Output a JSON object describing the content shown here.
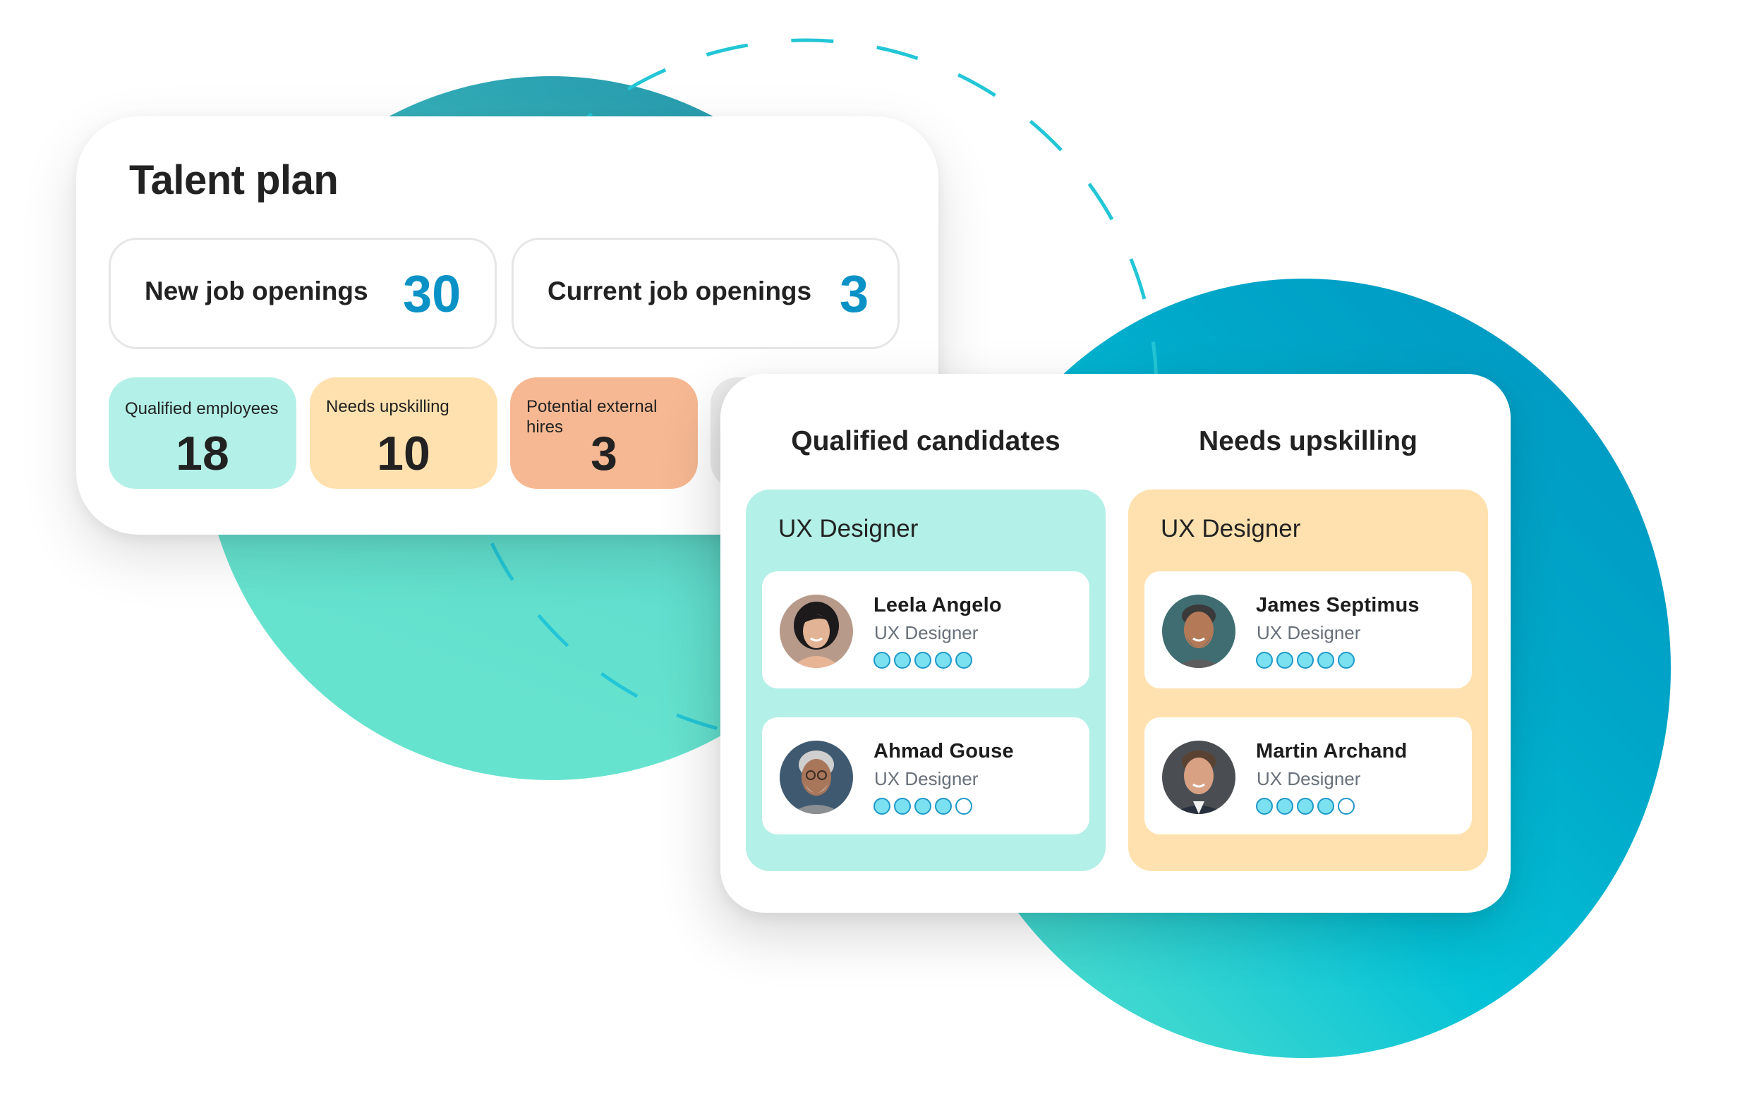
{
  "talent_plan": {
    "title": "Talent plan",
    "stats": [
      {
        "label": "New job openings",
        "value": "30"
      },
      {
        "label": "Current job openings",
        "value": "3"
      }
    ],
    "tiles": [
      {
        "label": "Qualified employees",
        "value": "18",
        "color": "#b3f0e7"
      },
      {
        "label": "Needs upskilling",
        "value": "10",
        "color": "#fee1ae"
      },
      {
        "label": "Potential external hires",
        "value": "3",
        "color": "#f6b892"
      }
    ]
  },
  "candidates": {
    "columns": [
      {
        "heading": "Qualified candidates",
        "group_title": "UX Designer",
        "color": "#b3f0e7",
        "people": [
          {
            "name": "Leela Angelo",
            "role": "UX Designer",
            "rating": 5,
            "rating_max": 5
          },
          {
            "name": "Ahmad Gouse",
            "role": "UX Designer",
            "rating": 4,
            "rating_max": 5
          }
        ]
      },
      {
        "heading": "Needs upskilling",
        "group_title": "UX Designer",
        "color": "#fee1ae",
        "people": [
          {
            "name": "James Septimus",
            "role": "UX Designer",
            "rating": 5,
            "rating_max": 5
          },
          {
            "name": "Martin Archand",
            "role": "UX Designer",
            "rating": 4,
            "rating_max": 5
          }
        ]
      }
    ]
  },
  "colors": {
    "accent_number": "#0a92c6",
    "rating_fill": "#7be0f0",
    "rating_border": "#1e98c9",
    "blob_teal": "#04c2d7",
    "blob_mint": "#66e3cf"
  }
}
